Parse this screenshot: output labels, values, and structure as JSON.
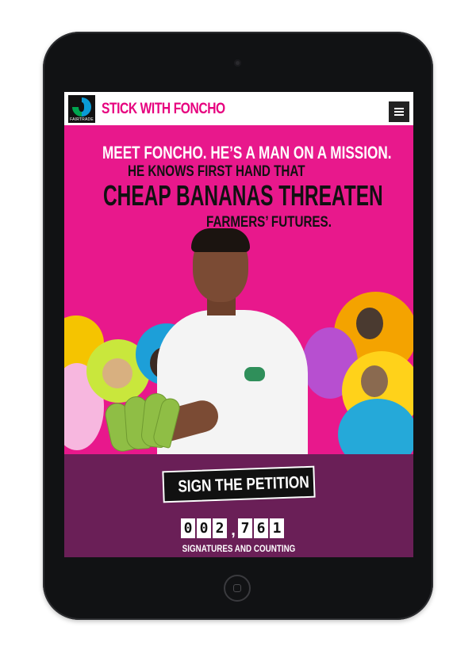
{
  "header": {
    "logo_text": "FAIRTRADE",
    "title": "STICK WITH FONCHO"
  },
  "hero": {
    "line1": "MEET FONCHO. HE’S A MAN ON A MISSION.",
    "line2": "HE KNOWS FIRST HAND THAT",
    "line3": "CHEAP BANANAS THREATEN",
    "line4": "FARMERS’ FUTURES."
  },
  "petition": {
    "button_label": "SIGN THE PETITION",
    "counter_digits": [
      "0",
      "0",
      "2",
      "7",
      "6",
      "1"
    ],
    "counter_separator": ",",
    "counter_label": "SIGNATURES AND COUNTING"
  },
  "colors": {
    "brand_pink": "#e6007e",
    "petition_purple": "#6a1f57",
    "device_black": "#111214"
  }
}
